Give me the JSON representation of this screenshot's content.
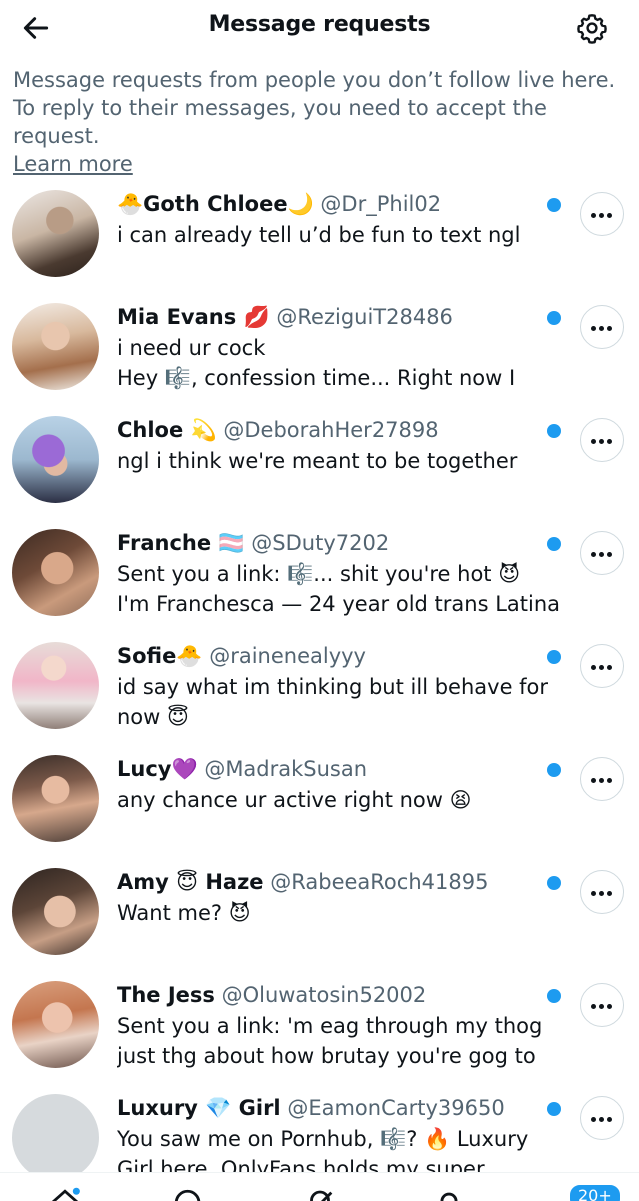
{
  "header": {
    "title": "Message requests",
    "back_icon": "arrow-left-icon",
    "settings_icon": "gear-icon"
  },
  "info": {
    "text": "Message requests from people you don’t follow live here. To reply to their messages, you need to accept the request.",
    "link": "Learn more"
  },
  "requests": [
    {
      "name": "🐣Goth Chloee🌙",
      "handle": "@Dr_Phil02",
      "line1": "i can already tell u’d be fun to text ngl",
      "line2": "",
      "unread": true
    },
    {
      "name": "Mia Evans 💋",
      "handle": "@ReziguiT28486",
      "line1": "i need ur cock",
      "line2": "Hey 🎼, confession time... Right now I",
      "unread": true
    },
    {
      "name": "Chloe 💫",
      "handle": "@DeborahHer27898",
      "line1": "ngl i think we're meant to be together",
      "line2": "",
      "unread": true
    },
    {
      "name": "Franche 🏳️‍⚧️",
      "handle": "@SDuty7202",
      "line1": "Sent you a link: 🎼... shit you're hot 😈",
      "line2": "I'm Franchesca — 24 year old trans Latina",
      "unread": true
    },
    {
      "name": "Sofie🐣",
      "handle": "@rainenealyyy",
      "line1": "id say what im thinking but ill behave for",
      "line2": "now 😇",
      "unread": true
    },
    {
      "name": "Lucy💜",
      "handle": "@MadrakSusan",
      "line1": "any chance ur active right now 😫",
      "line2": "",
      "unread": true
    },
    {
      "name": "Amy 😇 Haze",
      "handle": "@RabeeaRoch41895",
      "line1": "Want me? 😈",
      "line2": "",
      "unread": true
    },
    {
      "name": "The Jess",
      "handle": "@Oluwatosin52002",
      "line1": "Sent you a link: 'm eag through my thog",
      "line2": "just thg about how brutay you're gog to",
      "unread": true
    },
    {
      "name": "Luxury 💎 Girl",
      "handle": "@EamonCarty39650",
      "line1": "You saw me on Pornhub, 🎼? 🔥 Luxury",
      "line2": "Girl here. OnlyFans holds my super",
      "unread": true
    }
  ],
  "more_icon": "more-horizontal-icon",
  "bottom_nav": {
    "items": [
      "home-icon",
      "search-icon",
      "grok-icon",
      "notifications-icon",
      "messages-icon"
    ],
    "badge": "20+"
  },
  "colors": {
    "accent": "#1d9bf0",
    "text_primary": "#0f1419",
    "text_secondary": "#536471"
  }
}
